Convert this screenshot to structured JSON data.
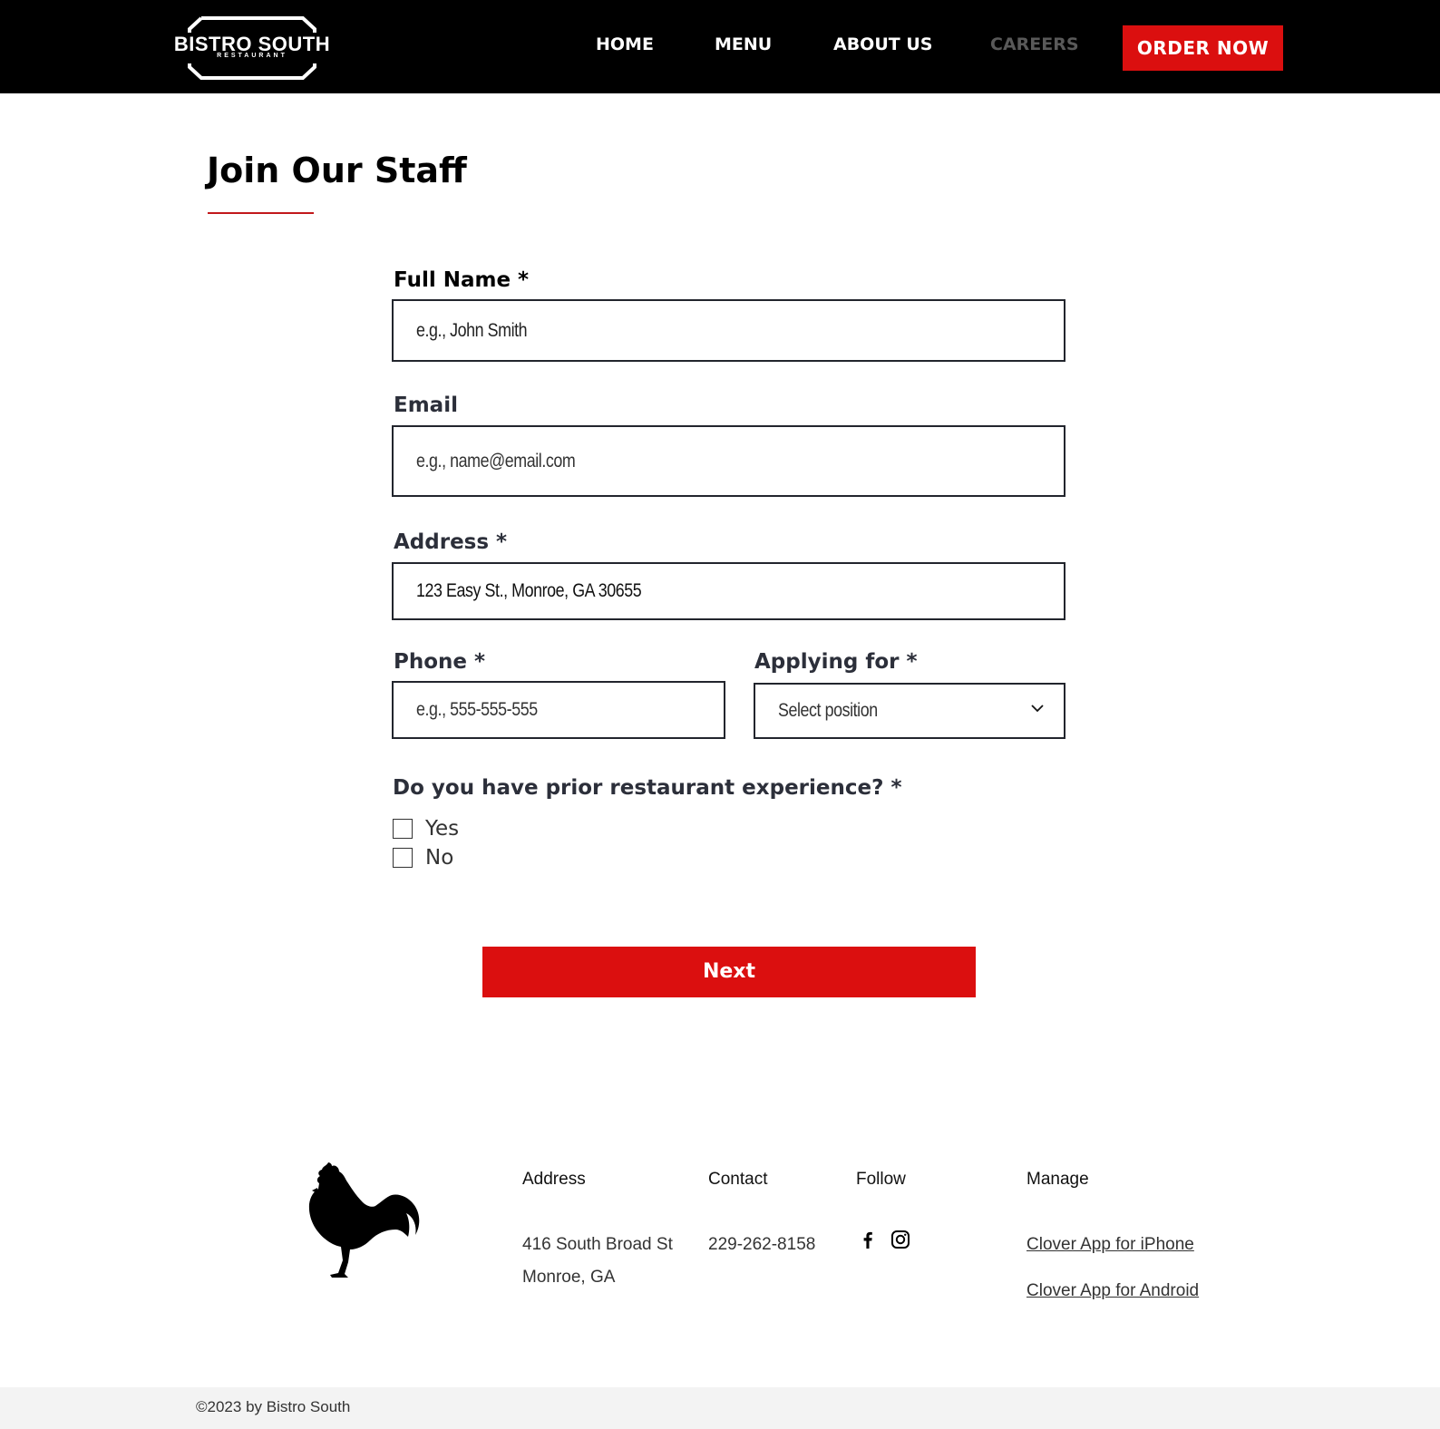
{
  "header": {
    "logo": {
      "name": "BISTRO SOUTH",
      "sub": "RESTAURANT"
    },
    "nav": [
      {
        "label": "HOME"
      },
      {
        "label": "MENU"
      },
      {
        "label": "ABOUT US"
      },
      {
        "label": "CAREERS",
        "current": true
      }
    ],
    "order_button": "ORDER NOW"
  },
  "page": {
    "title": "Join Our Staff"
  },
  "form": {
    "full_name": {
      "label": "Full Name *",
      "placeholder": "e.g., John Smith"
    },
    "email": {
      "label": "Email",
      "placeholder": "e.g., name@email.com"
    },
    "address": {
      "label": "Address *",
      "value": "123 Easy St., Monroe, GA 30655"
    },
    "phone": {
      "label": "Phone *",
      "placeholder": "e.g., 555-555-555"
    },
    "applying_for": {
      "label": "Applying for *",
      "selected": "Select position"
    },
    "experience": {
      "question": "Do you have prior restaurant experience? *",
      "options": [
        "Yes",
        "No"
      ]
    },
    "next_button": "Next"
  },
  "footer": {
    "address": {
      "heading": "Address",
      "line1": "416 South Broad St",
      "line2": "Monroe, GA"
    },
    "contact": {
      "heading": "Contact",
      "phone": "229-262-8158"
    },
    "follow": {
      "heading": "Follow",
      "icons": [
        "facebook-icon",
        "instagram-icon"
      ]
    },
    "manage": {
      "heading": "Manage",
      "links": [
        "Clover App for iPhone",
        "Clover App for Android"
      ]
    },
    "copyright": "©2023 by Bistro South"
  },
  "colors": {
    "accent": "#db0f0f",
    "header_bg": "#000000",
    "underline": "#c2181b"
  }
}
